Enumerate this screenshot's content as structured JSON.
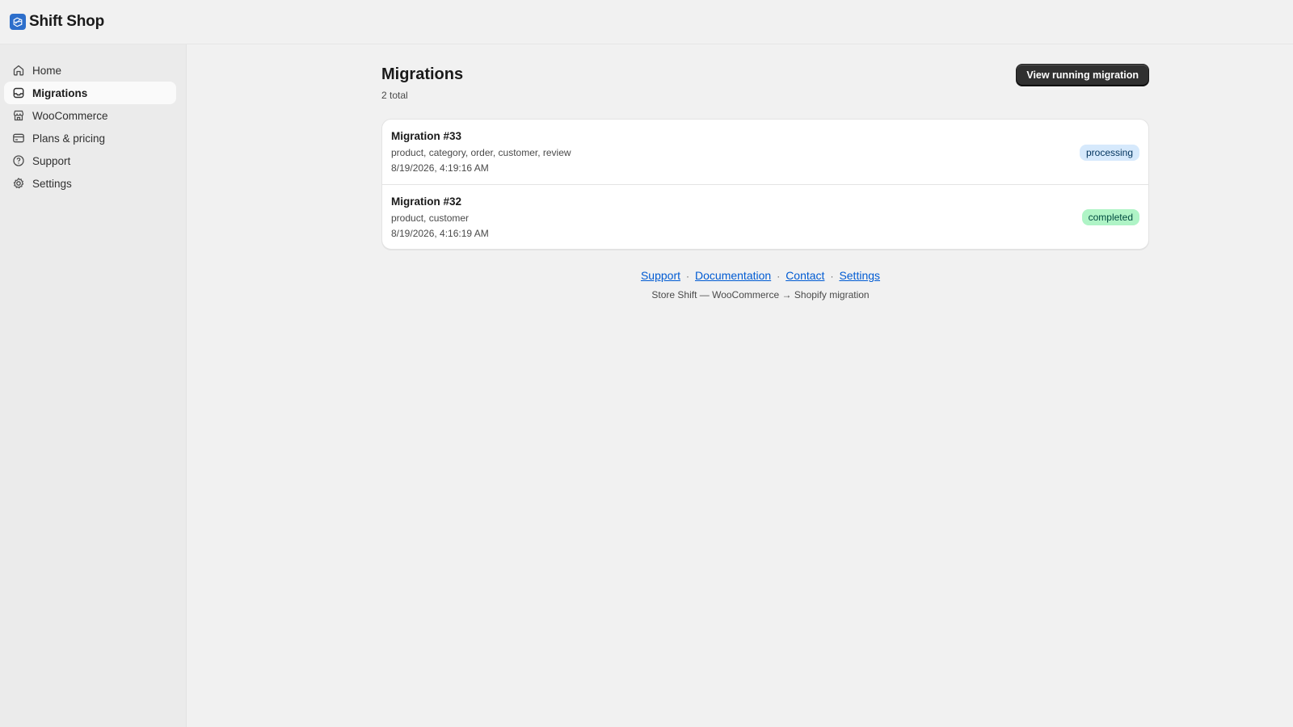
{
  "app": {
    "title": "Shift Shop",
    "icon": "store-shift-app-icon",
    "accent": "#2c6ecb"
  },
  "sidebar": {
    "items": [
      {
        "label": "Home",
        "icon": "home-icon",
        "active": false
      },
      {
        "label": "Migrations",
        "icon": "inbox-icon",
        "active": true
      },
      {
        "label": "WooCommerce",
        "icon": "store-icon",
        "active": false
      },
      {
        "label": "Plans & pricing",
        "icon": "credit-card-icon",
        "active": false
      },
      {
        "label": "Support",
        "icon": "question-circle-icon",
        "active": false
      },
      {
        "label": "Settings",
        "icon": "gear-icon",
        "active": false
      }
    ]
  },
  "page": {
    "title": "Migrations",
    "subtitle": "2 total",
    "primary_action": "View running migration"
  },
  "migrations": [
    {
      "title": "Migration #33",
      "entities": "product, category, order, customer, review",
      "timestamp": "8/19/2026, 4:19:16 AM",
      "status": "processing",
      "status_bg": "#d6e9fc",
      "status_color": "#00325c"
    },
    {
      "title": "Migration #32",
      "entities": "product, customer",
      "timestamp": "8/19/2026, 4:16:19 AM",
      "status": "completed",
      "status_bg": "#aff4c6",
      "status_color": "#014b40"
    }
  ],
  "footer": {
    "links": [
      "Support",
      "Documentation",
      "Contact",
      "Settings"
    ],
    "separator": "·",
    "note": "Store Shift — WooCommerce → Shopify migration"
  }
}
